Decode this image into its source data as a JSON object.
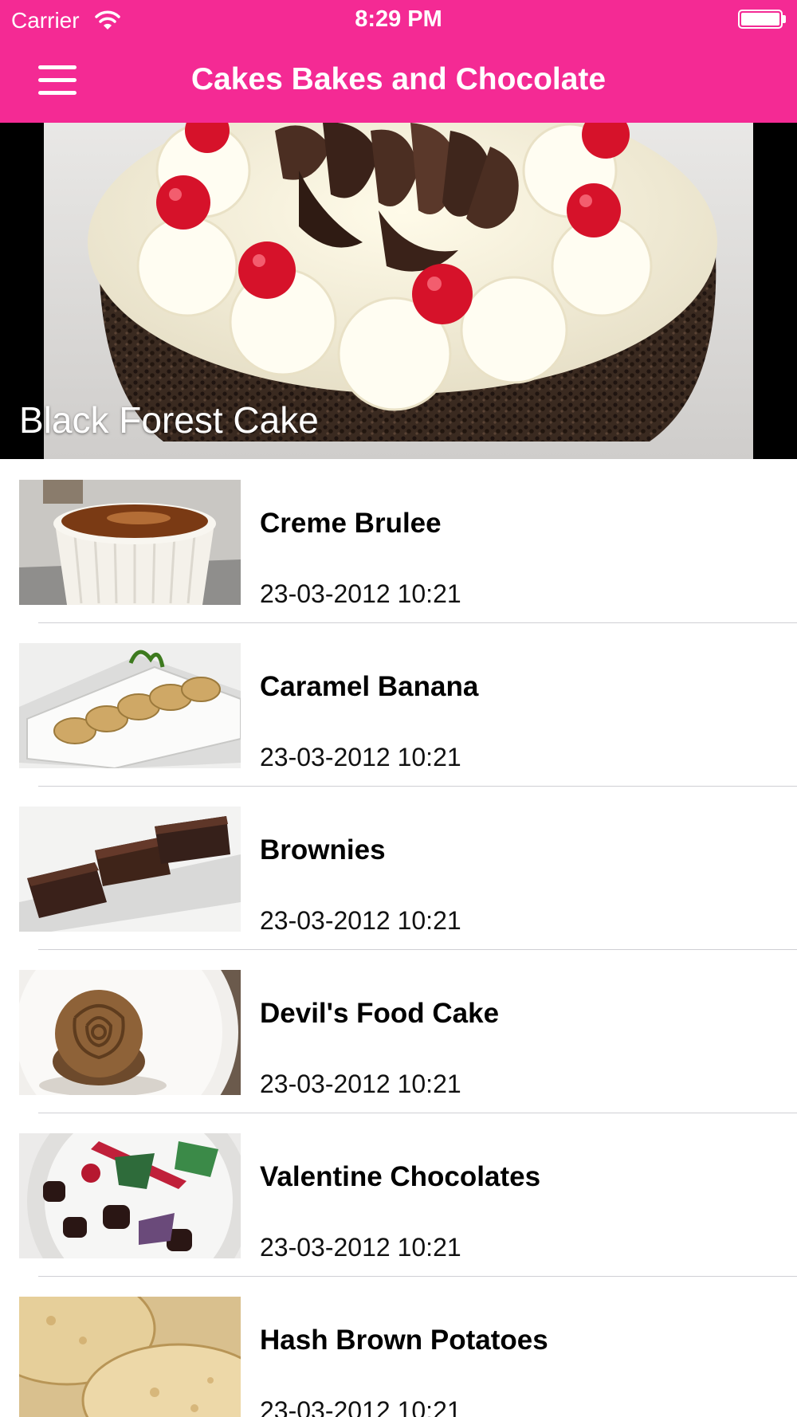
{
  "status_bar": {
    "carrier": "Carrier",
    "time": "8:29 PM",
    "wifi_icon": "wifi-icon",
    "battery_icon": "battery-icon",
    "battery_level": 1.0
  },
  "nav": {
    "title": "Cakes Bakes and Chocolate",
    "menu_icon": "hamburger-menu-icon",
    "color": "#F42A94"
  },
  "hero": {
    "caption": "Black Forest Cake"
  },
  "list": {
    "items": [
      {
        "title": "Creme Brulee",
        "date": "23-03-2012 10:21"
      },
      {
        "title": "Caramel Banana",
        "date": "23-03-2012 10:21"
      },
      {
        "title": "Brownies",
        "date": "23-03-2012 10:21"
      },
      {
        "title": "Devil's Food Cake",
        "date": "23-03-2012 10:21"
      },
      {
        "title": "Valentine Chocolates",
        "date": "23-03-2012 10:21"
      },
      {
        "title": "Hash Brown Potatoes",
        "date": "23-03-2012 10:21"
      }
    ]
  }
}
